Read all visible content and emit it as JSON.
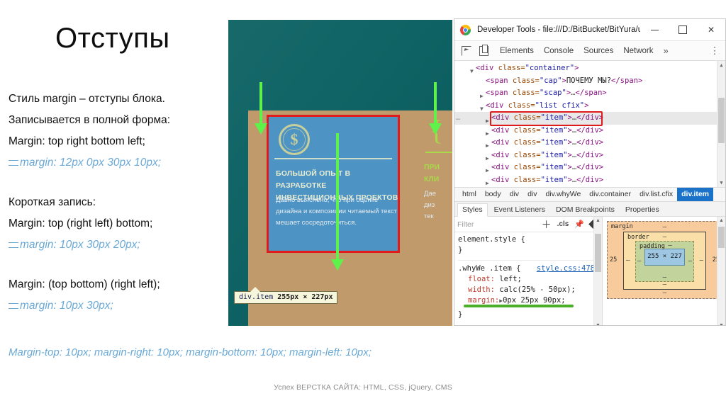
{
  "slide": {
    "title": "Отступы",
    "lines": [
      {
        "text": "Стиль margin –  отступы блока.",
        "style": "plain"
      },
      {
        "text": "Записывается в полной форма:",
        "style": "plain"
      },
      {
        "text": "Margin: top right bottom left;",
        "style": "plain"
      },
      {
        "text": "margin: 12px 0px 30px 10px;",
        "style": "code"
      },
      {
        "text": "Короткая запись:",
        "style": "plain",
        "gap_before": true
      },
      {
        "text": "Margin: top (right left) bottom;",
        "style": "plain"
      },
      {
        "text": "margin: 10px 30px 20px;",
        "style": "code"
      },
      {
        "text": "Margin: (top bottom) (right left);",
        "style": "plain",
        "gap_before": true
      },
      {
        "text": "margin: 10px 30px;",
        "style": "code"
      }
    ],
    "footer_note": "Margin-top: 10px; margin-right: 10px; margin-bottom: 10px; margin-left: 10px;",
    "credit": "Успех ВЕРСТКА САЙТА: HTML, CSS, jQuery, CMS"
  },
  "preview": {
    "background_color": "#0a6061",
    "margin_band_color": "#c09a6b",
    "highlight_color": "#e01b1b",
    "arrow_color": "#5ef24a",
    "card": {
      "icon": "dollar-coin-icon",
      "icon_glyph": "$",
      "heading": "БОЛЬШОЙ ОПЫТ В РАЗРАБОТКЕ ИНВЕСТИЦИОННЫХ ПРОЕКТОВ",
      "paragraph": "Давно выяснено, что при оценке дизайна и композиции читаемый текст мешает сосредоточиться."
    },
    "card2": {
      "icon": "brace-icon",
      "icon_glyph": "{",
      "heading_line1": "ПРИ",
      "heading_line2": "КЛИ",
      "paragraph_line1": "Дае",
      "paragraph_line2": "диз",
      "paragraph_line3": "тек"
    },
    "tooltip": {
      "selector": "div.item",
      "dimensions": "255px × 227px"
    }
  },
  "devtools": {
    "window_title": "Developer Tools - file:///D:/BitBucket/BitYura/uni...",
    "window_controls": {
      "minimize": "minimize-button",
      "maximize": "maximize-button",
      "close": "close-button"
    },
    "toolbar": {
      "inspect_icon": "inspect-element-icon",
      "device_icon": "device-toolbar-icon",
      "tabs": [
        "Elements",
        "Console",
        "Sources",
        "Network"
      ],
      "more_tabs": "»",
      "kebab": "⋮"
    },
    "dom_tree": [
      {
        "indent": 1,
        "triangle": "▼",
        "text_parts": {
          "tag_open": "<div",
          "attr": " class=",
          "val": "\"container\"",
          "tag_close": ">"
        },
        "selected": false
      },
      {
        "indent": 2,
        "triangle": "",
        "text_parts": {
          "tag_open": "<span",
          "attr": " class=",
          "val": "\"cap\"",
          "tag_close": ">",
          "inner": "ПОЧЕМУ МЫ?",
          "end": "</span>"
        },
        "selected": false
      },
      {
        "indent": 2,
        "triangle": "▶",
        "text_parts": {
          "tag_open": "<span",
          "attr": " class=",
          "val": "\"scap\"",
          "tag_close": ">",
          "inner": "…",
          "end": "</span>"
        },
        "selected": false
      },
      {
        "indent": 2,
        "triangle": "▼",
        "text_parts": {
          "tag_open": "<div",
          "attr": " class=",
          "val": "\"list cfix\"",
          "tag_close": ">"
        },
        "selected": false
      },
      {
        "indent": 3,
        "triangle": "▶",
        "text_parts": {
          "tag_open": "<div",
          "attr": " class=",
          "val": "\"item\"",
          "tag_close": ">",
          "inner": "…",
          "end": "</div>"
        },
        "selected": true
      },
      {
        "indent": 3,
        "triangle": "▶",
        "text_parts": {
          "tag_open": "<div",
          "attr": " class=",
          "val": "\"item\"",
          "tag_close": ">",
          "inner": "…",
          "end": "</div>"
        },
        "selected": false
      },
      {
        "indent": 3,
        "triangle": "▶",
        "text_parts": {
          "tag_open": "<div",
          "attr": " class=",
          "val": "\"item\"",
          "tag_close": ">",
          "inner": "…",
          "end": "</div>"
        },
        "selected": false
      },
      {
        "indent": 3,
        "triangle": "▶",
        "text_parts": {
          "tag_open": "<div",
          "attr": " class=",
          "val": "\"item\"",
          "tag_close": ">",
          "inner": "…",
          "end": "</div>"
        },
        "selected": false
      },
      {
        "indent": 3,
        "triangle": "▶",
        "text_parts": {
          "tag_open": "<div",
          "attr": " class=",
          "val": "\"item\"",
          "tag_close": ">",
          "inner": "…",
          "end": "</div>"
        },
        "selected": false
      },
      {
        "indent": 3,
        "triangle": "▶",
        "text_parts": {
          "tag_open": "<div",
          "attr": " class=",
          "val": "\"item\"",
          "tag_close": ">",
          "inner": "…",
          "end": "</div>"
        },
        "selected": false
      }
    ],
    "breadcrumb": [
      "html",
      "body",
      "div",
      "div",
      "div.whyWe",
      "div.container",
      "div.list.cfix",
      "div.item"
    ],
    "breadcrumb_active_index": 7,
    "styles_tabs": [
      "Styles",
      "Event Listeners",
      "DOM Breakpoints",
      "Properties"
    ],
    "styles_active_tab": "Styles",
    "filter_placeholder": "Filter",
    "filter_tools": {
      "new_rule": "plus-icon",
      "cls": ".cls",
      "pin": "pin-icon",
      "render": "diamond-icon"
    },
    "css_rules": [
      {
        "selector": "element.style {",
        "source": "",
        "declarations": [],
        "close": "}"
      },
      {
        "selector": ".whyWe .item {",
        "source": "style.css:478",
        "declarations": [
          {
            "prop": "float:",
            "value": "left;",
            "expandable": false,
            "highlighted": false
          },
          {
            "prop": "width:",
            "value": "calc(25% - 50px);",
            "expandable": false,
            "highlighted": false
          },
          {
            "prop": "margin:",
            "value": "0px 25px 90px;",
            "expandable": true,
            "highlighted": true
          }
        ],
        "close": "}"
      }
    ],
    "box_model": {
      "margin_label": "margin",
      "margin_top": "–",
      "margin_bottom": "–",
      "margin_left": "25",
      "margin_right": "25",
      "border_label": "border",
      "border_top": "–",
      "border_bottom": "–",
      "border_left": "–",
      "border_right": "–",
      "padding_label": "padding",
      "padding_top": "–",
      "padding_bottom": "–",
      "padding_left": "–",
      "padding_right": "–",
      "content_size": "255 × 227"
    }
  }
}
